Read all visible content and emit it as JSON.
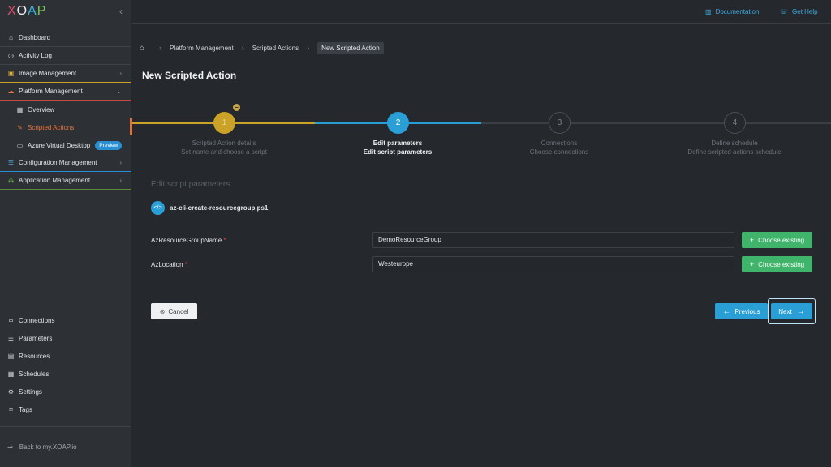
{
  "app": {
    "logo_letters": [
      "X",
      "O",
      "A",
      "P"
    ],
    "logo_colors": [
      "#e14b6a",
      "#f0f0f0",
      "#33b6e6",
      "#7acb4a"
    ]
  },
  "sidebar": {
    "top_items": [
      {
        "label": "Dashboard",
        "icon": "home-icon"
      },
      {
        "label": "Activity Log",
        "icon": "clock-icon"
      },
      {
        "label": "Image Management",
        "icon": "image-icon"
      },
      {
        "label": "Platform Management",
        "icon": "cloud-icon"
      },
      {
        "label": "Overview",
        "icon": "grid-icon"
      },
      {
        "label": "Scripted Actions",
        "icon": "pen-icon"
      },
      {
        "label": "Azure Virtual Desktop",
        "icon": "monitor-icon",
        "badge": "Preview"
      },
      {
        "label": "Configuration Management",
        "icon": "sliders-icon"
      },
      {
        "label": "Application Management",
        "icon": "apps-icon"
      }
    ],
    "bottom_items": [
      {
        "label": "Connections",
        "icon": "link-icon"
      },
      {
        "label": "Parameters",
        "icon": "list-icon"
      },
      {
        "label": "Resources",
        "icon": "box-icon"
      },
      {
        "label": "Schedules",
        "icon": "calendar-icon"
      },
      {
        "label": "Settings",
        "icon": "gear-icon"
      },
      {
        "label": "Tags",
        "icon": "bookmark-icon"
      }
    ],
    "back_label": "Back to my.XOAP.io"
  },
  "header": {
    "documentation": "Documentation",
    "get_help": "Get Help"
  },
  "breadcrumb": {
    "items": [
      "Platform Management",
      "Scripted Actions",
      "New Scripted Action"
    ]
  },
  "page": {
    "title": "New Scripted Action"
  },
  "stepper": {
    "steps": [
      {
        "number": "1",
        "title": "Scripted Action details",
        "subtitle": "Set name and choose a script",
        "state": "done"
      },
      {
        "number": "2",
        "title": "Edit parameters",
        "subtitle": "Edit script parameters",
        "state": "active"
      },
      {
        "number": "3",
        "title": "Connections",
        "subtitle": "Choose connections",
        "state": "pending"
      },
      {
        "number": "4",
        "title": "Define schedule",
        "subtitle": "Define scripted actions schedule",
        "state": "pending"
      }
    ],
    "colors": {
      "done": "#c9a227",
      "active": "#2a9fd6",
      "pending": "#3a3f45"
    }
  },
  "form": {
    "section_title": "Edit script parameters",
    "script_name": "az-cli-create-resourcegroup.ps1",
    "fields": [
      {
        "label": "AzResourceGroupName",
        "required": "*",
        "value": "DemoResourceGroup",
        "button": "Choose existing"
      },
      {
        "label": "AzLocation",
        "required": "*",
        "value": "Westeurope",
        "button": "Choose existing"
      }
    ]
  },
  "actions": {
    "cancel": "Cancel",
    "previous": "Previous",
    "next": "Next"
  }
}
